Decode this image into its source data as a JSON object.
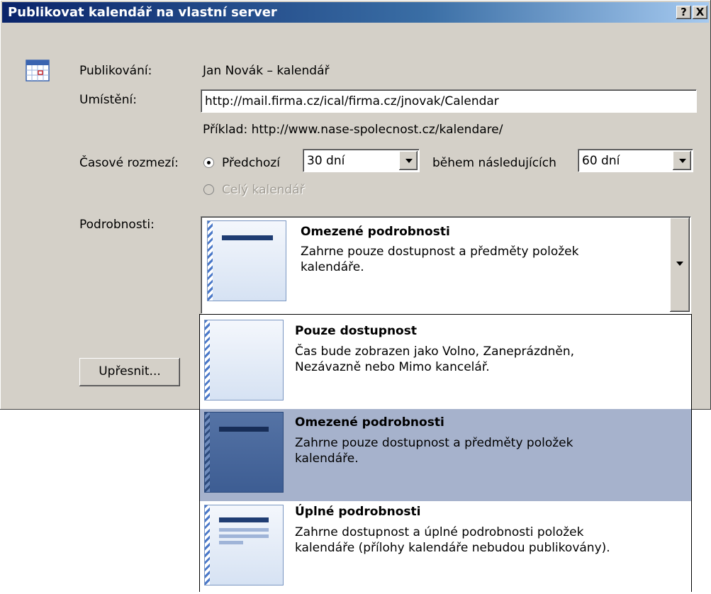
{
  "window": {
    "title": "Publikovat kalendář na vlastní server",
    "help_button": "?",
    "close_button": "X"
  },
  "form": {
    "publishing_label": "Publikování:",
    "publishing_value": "Jan Novák – kalendář",
    "location_label": "Umístění:",
    "location_value": "http://mail.firma.cz/ical/firma.cz/jnovak/Calendar",
    "example_text": "Příklad: http://www.nase-spolecnost.cz/kalendare/",
    "time_range_label": "Časové rozmezí:",
    "previous_label": "Předchozí",
    "previous_value": "30 dní",
    "next_label": "během následujících",
    "next_value": "60 dní",
    "whole_calendar_label": "Celý kalendář",
    "details_label": "Podrobnosti:",
    "advanced_button": "Upřesnit..."
  },
  "details_selected": {
    "title": "Omezené podrobnosti",
    "desc_line1": "Zahrne pouze dostupnost a předměty položek",
    "desc_line2": "kalendáře."
  },
  "dropdown_options": [
    {
      "title": "Pouze dostupnost",
      "desc_line1": "Čas bude zobrazen jako Volno, Zaneprázdněn,",
      "desc_line2": "Nezávazně nebo Mimo kancelář."
    },
    {
      "title": "Omezené podrobnosti",
      "desc_line1": "Zahrne pouze dostupnost a předměty položek",
      "desc_line2": "kalendáře."
    },
    {
      "title": "Úplné podrobnosti",
      "desc_line1": "Zahrne dostupnost a úplné podrobnosti položek",
      "desc_line2": "kalendáře (přílohy kalendáře nebudou publikovány)."
    }
  ],
  "colors": {
    "titlebar": "#0a246a",
    "dialog_bg": "#d4d0c8",
    "selected_item": "#a6b2cc"
  }
}
